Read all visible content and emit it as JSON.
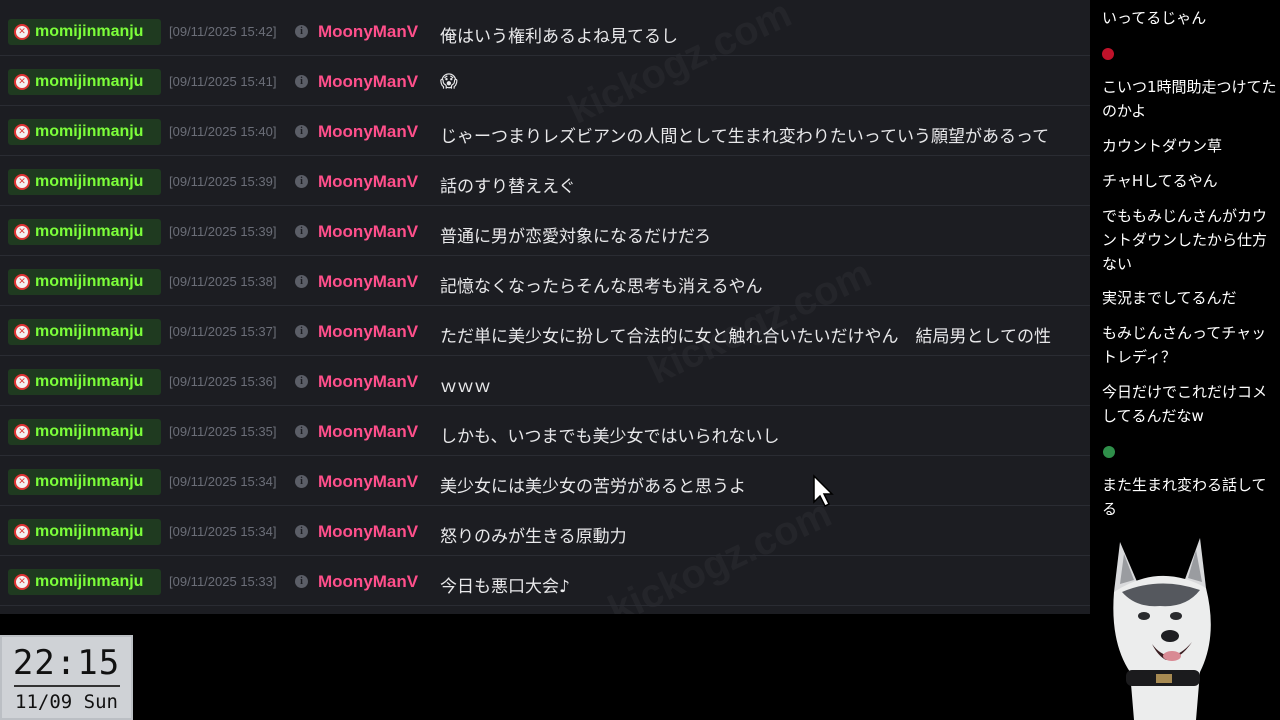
{
  "chat_log": {
    "rows": [
      {
        "user": "momijinmanju",
        "timestamp": "[09/11/2025 15:42]",
        "author": "MoonyManV",
        "message": "俺はいう権利あるよね見てるし"
      },
      {
        "user": "momijinmanju",
        "timestamp": "[09/11/2025 15:41]",
        "author": "MoonyManV",
        "message": "😱"
      },
      {
        "user": "momijinmanju",
        "timestamp": "[09/11/2025 15:40]",
        "author": "MoonyManV",
        "message": "じゃーつまりレズビアンの人間として生まれ変わりたいっていう願望があるって"
      },
      {
        "user": "momijinmanju",
        "timestamp": "[09/11/2025 15:39]",
        "author": "MoonyManV",
        "message": "話のすり替ええぐ"
      },
      {
        "user": "momijinmanju",
        "timestamp": "[09/11/2025 15:39]",
        "author": "MoonyManV",
        "message": "普通に男が恋愛対象になるだけだろ"
      },
      {
        "user": "momijinmanju",
        "timestamp": "[09/11/2025 15:38]",
        "author": "MoonyManV",
        "message": "記憶なくなったらそんな思考も消えるやん"
      },
      {
        "user": "momijinmanju",
        "timestamp": "[09/11/2025 15:37]",
        "author": "MoonyManV",
        "message": "ただ単に美少女に扮して合法的に女と触れ合いたいだけやん　結局男としての性"
      },
      {
        "user": "momijinmanju",
        "timestamp": "[09/11/2025 15:36]",
        "author": "MoonyManV",
        "message": "ｗｗｗ"
      },
      {
        "user": "momijinmanju",
        "timestamp": "[09/11/2025 15:35]",
        "author": "MoonyManV",
        "message": "しかも、いつまでも美少女ではいられないし"
      },
      {
        "user": "momijinmanju",
        "timestamp": "[09/11/2025 15:34]",
        "author": "MoonyManV",
        "message": "美少女には美少女の苦労があると思うよ"
      },
      {
        "user": "momijinmanju",
        "timestamp": "[09/11/2025 15:34]",
        "author": "MoonyManV",
        "message": "怒りのみが生きる原動力"
      },
      {
        "user": "momijinmanju",
        "timestamp": "[09/11/2025 15:33]",
        "author": "MoonyManV",
        "message": "今日も悪口大会♪"
      }
    ]
  },
  "side_chat": {
    "messages": [
      "いってるじゃん",
      "こいつ1時間助走つけてたのかよ",
      "カウントダウン草",
      "チャHしてるやん",
      "でももみじんさんがカウントダウンしたから仕方ない",
      "実況までしてるんだ",
      "もみじんさんってチャットレディ？",
      "今日だけでこれだけコメしてるんだなw",
      "また生まれ変わる話してる"
    ]
  },
  "clock": {
    "time": "22:15",
    "date": "11/09 Sun"
  },
  "colors": {
    "panel_bg": "#1c1d22",
    "username_green": "#7cff3a",
    "author_pink": "#ff4f8b",
    "timestamp_gray": "#6b6e78"
  },
  "icons": {
    "badge": "no-entry-avatar-icon",
    "info": "info-icon",
    "cursor": "mouse-pointer-icon"
  }
}
